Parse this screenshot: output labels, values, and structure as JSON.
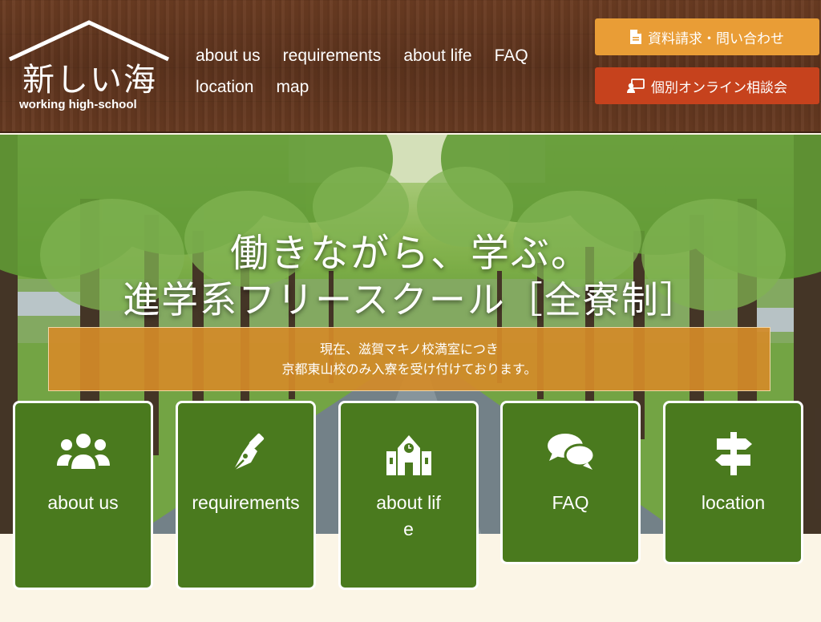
{
  "header": {
    "logo_kanji": "新しい海",
    "logo_sub": "working high-school",
    "nav": [
      "about us",
      "requirements",
      "about life",
      "FAQ",
      "location",
      "map"
    ],
    "btn_doc": "資料請求・問い合わせ",
    "btn_consult": "個別オンライン相談会"
  },
  "hero": {
    "headline_1": "働きながら、学ぶ。",
    "headline_2": "進学系フリースクール［全寮制］",
    "notice_line1": "現在、滋賀マキノ校満室につき",
    "notice_line2": "京都東山校のみ入寮を受け付けております。"
  },
  "cards": [
    {
      "label": "about us",
      "icon": "people-group-icon"
    },
    {
      "label": "requirements",
      "icon": "pen-nib-icon"
    },
    {
      "label": "about life",
      "icon": "school-building-icon"
    },
    {
      "label": "FAQ",
      "icon": "speech-bubbles-icon"
    },
    {
      "label": "location",
      "icon": "signpost-icon"
    }
  ],
  "colors": {
    "header_wood": "#5c331d",
    "doc_button": "#e99d36",
    "consult_button": "#c6421d",
    "notice_band": "#d38b29",
    "card_green": "#4a7a1e",
    "page_bg": "#fbf5e6"
  }
}
